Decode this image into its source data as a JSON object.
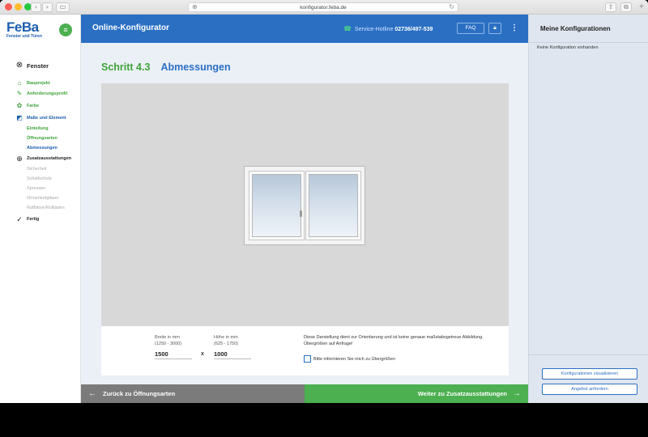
{
  "browser": {
    "url": "konfigurator.feba.de",
    "traffic_lights": {
      "red": "#ff5f57",
      "yellow": "#febc2e",
      "green": "#28c840"
    }
  },
  "brand": {
    "logo_main": "FeBa",
    "tagline": "Fenster und Türen",
    "color": "#1d5eaf",
    "accent": "#4caf50"
  },
  "header": {
    "title": "Online-Konfigurator",
    "hotline_label": "Service-Hotline",
    "hotline_number": "02736/497-539",
    "faq_label": "FAQ"
  },
  "sidebar": {
    "section_title": "Fenster",
    "items": [
      {
        "label": "Bauprojekt",
        "state": "done",
        "icon": "house-icon"
      },
      {
        "label": "Anforderungsprofil",
        "state": "done",
        "icon": "leaf-icon"
      },
      {
        "label": "Farbe",
        "state": "done",
        "icon": "palette-icon"
      },
      {
        "label": "Maße und Element",
        "state": "active",
        "icon": "ruler-icon"
      },
      {
        "label": "Einteilung",
        "state": "done-sub"
      },
      {
        "label": "Öffnungsarten",
        "state": "done-sub"
      },
      {
        "label": "Abmessungen",
        "state": "active-sub"
      },
      {
        "label": "Zusatzausstattungen",
        "state": "section",
        "icon": "plus-circle-icon"
      },
      {
        "label": "Sicherheit",
        "state": "disabled"
      },
      {
        "label": "Schallschutz",
        "state": "disabled"
      },
      {
        "label": "Sprossen",
        "state": "disabled"
      },
      {
        "label": "Ornamentgläser",
        "state": "disabled"
      },
      {
        "label": "Raffstore/Rollläden",
        "state": "disabled"
      },
      {
        "label": "Fertig",
        "state": "section",
        "icon": "checkmark-icon"
      }
    ]
  },
  "main": {
    "step_number": "Schritt 4.3",
    "step_name": "Abmessungen",
    "width": {
      "label": "Breite in mm",
      "range": "(1250 - 3000)",
      "value": "1500"
    },
    "height": {
      "label": "Höhe in mm",
      "range": "(625 - 1750)",
      "value": "1000"
    },
    "separator": "x",
    "note": "Diese Darstellung dient zur Orientierung und ist keine genaue maßstabsgetreue Abbildung. Übergrößen auf Anfrage!",
    "checkbox_label": "Bitte informieren Sie mich zu Übergrößen",
    "checkbox_checked": false
  },
  "footer": {
    "back_label": "Zurück zu Öffnungsarten",
    "next_label": "Weiter zu Zusatzausstattungen"
  },
  "right_panel": {
    "title": "Meine Konfigurationen",
    "empty_text": "Keine Konfiguration vorhanden",
    "visualize_label": "Konfigurationen visualisieren",
    "offer_label": "Angebot anfordern"
  }
}
